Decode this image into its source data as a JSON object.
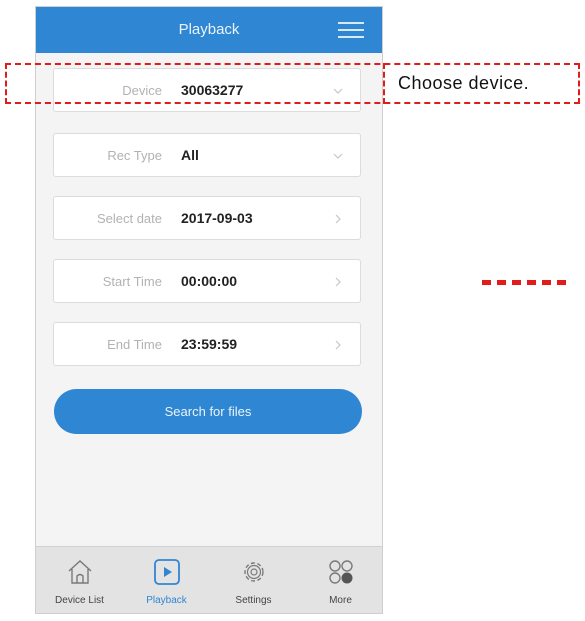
{
  "header": {
    "title": "Playback",
    "menu_icon": "hamburger-menu-icon"
  },
  "form": {
    "fields": [
      {
        "label": "Device",
        "value": "30063277",
        "icon": "chevron-down-icon"
      },
      {
        "label": "Rec Type",
        "value": "All",
        "icon": "chevron-down-icon"
      },
      {
        "label": "Select date",
        "value": "2017-09-03",
        "icon": "chevron-right-icon"
      },
      {
        "label": "Start Time",
        "value": "00:00:00",
        "icon": "chevron-right-icon"
      },
      {
        "label": "End Time",
        "value": "23:59:59",
        "icon": "chevron-right-icon"
      }
    ],
    "search_label": "Search for files"
  },
  "tabbar": {
    "tabs": [
      {
        "label": "Device List",
        "icon": "home-icon"
      },
      {
        "label": "Playback",
        "icon": "play-icon",
        "active": true
      },
      {
        "label": "Settings",
        "icon": "gear-icon"
      },
      {
        "label": "More",
        "icon": "more-icon"
      }
    ]
  },
  "annotation": {
    "callout_text": "Choose device."
  },
  "colors": {
    "accent": "#2f86d2",
    "annotation": "#e21b1b",
    "background": "#f4f4f4"
  }
}
